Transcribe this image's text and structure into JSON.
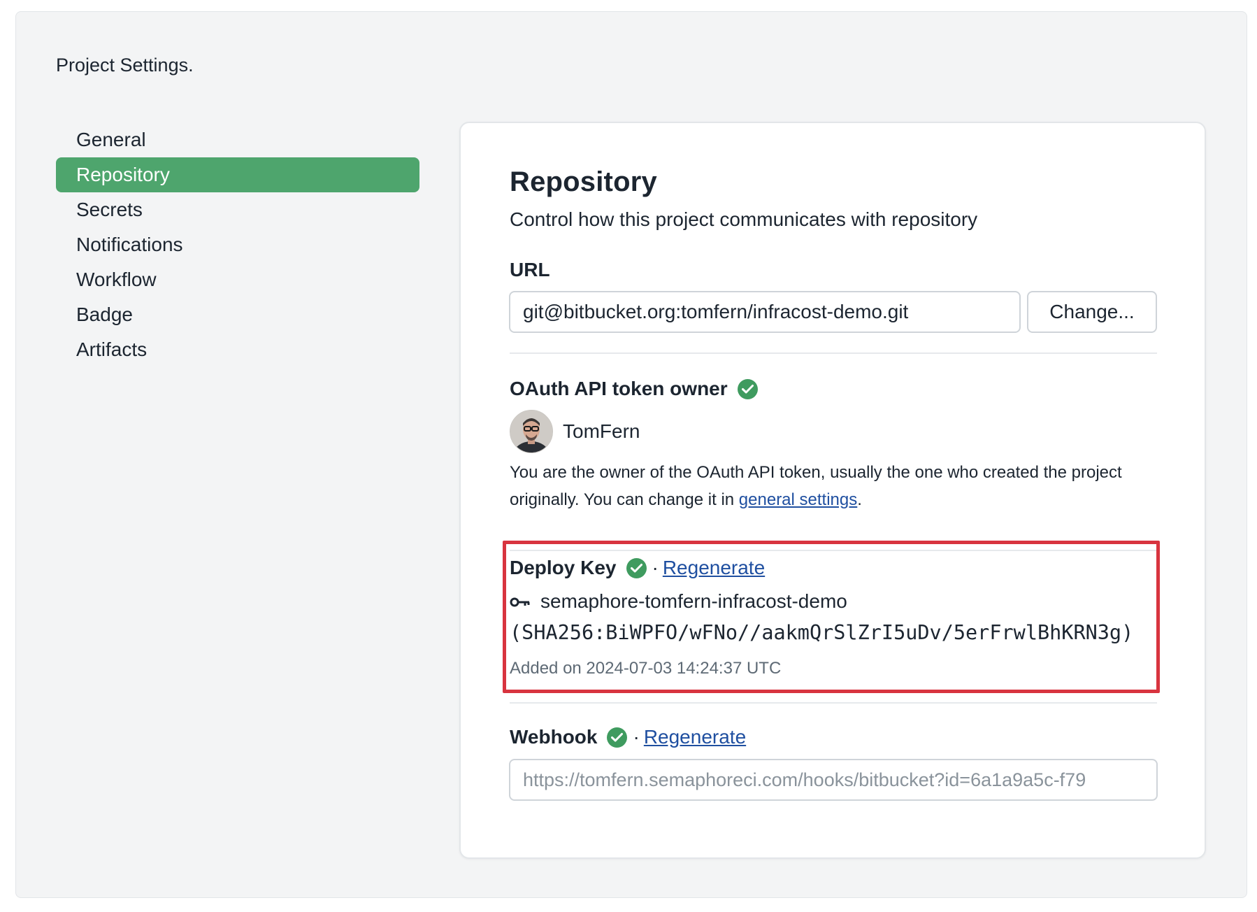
{
  "breadcrumb": "Project Settings.",
  "sidebar": {
    "items": [
      {
        "label": "General",
        "active": false
      },
      {
        "label": "Repository",
        "active": true
      },
      {
        "label": "Secrets",
        "active": false
      },
      {
        "label": "Notifications",
        "active": false
      },
      {
        "label": "Workflow",
        "active": false
      },
      {
        "label": "Badge",
        "active": false
      },
      {
        "label": "Artifacts",
        "active": false
      }
    ]
  },
  "repository": {
    "title": "Repository",
    "subtitle": "Control how this project communicates with repository",
    "url_label": "URL",
    "url_value": "git@bitbucket.org:tomfern/infracost-demo.git",
    "change_button": "Change..."
  },
  "oauth": {
    "heading": "OAuth API token owner",
    "owner_name": "TomFern",
    "description_prefix": "You are the owner of the OAuth API token, usually the one who created the project originally. You can change it in ",
    "link_text": "general settings",
    "description_suffix": "."
  },
  "deploy_key": {
    "heading": "Deploy Key",
    "separator": "·",
    "regenerate": "Regenerate",
    "key_name": "semaphore-tomfern-infracost-demo",
    "fingerprint": "(SHA256:BiWPFO/wFNo//aakmQrSlZrI5uDv/5erFrwlBhKRN3g)",
    "added": "Added on 2024-07-03 14:24:37 UTC"
  },
  "webhook": {
    "heading": "Webhook",
    "separator": "·",
    "regenerate": "Regenerate",
    "url": "https://tomfern.semaphoreci.com/hooks/bitbucket?id=6a1a9a5c-f79"
  },
  "colors": {
    "accent_green": "#4ea56d",
    "check_green": "#3f9b5f",
    "highlight_red": "#d8343f",
    "link_blue": "#1f4fa0"
  },
  "icons": {
    "verified": "check-circle-icon",
    "key": "key-icon"
  }
}
